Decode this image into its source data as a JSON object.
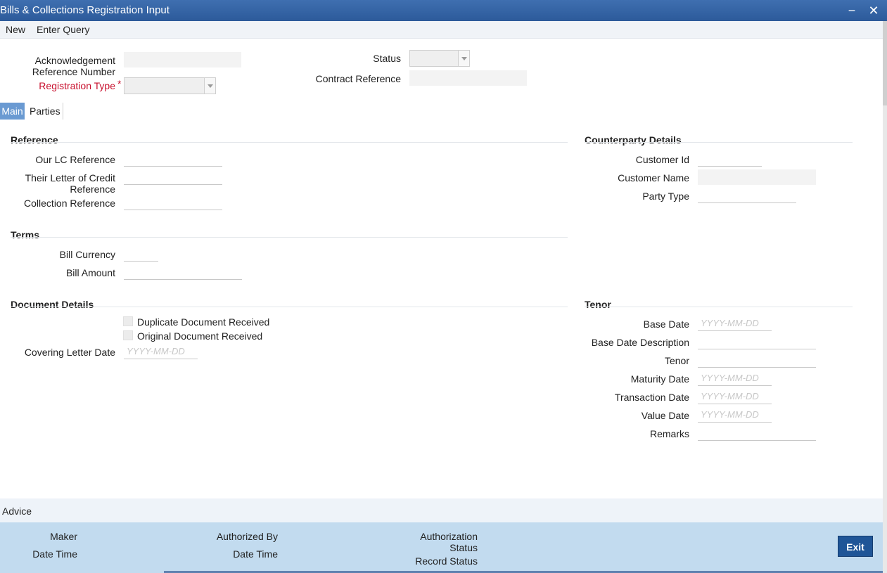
{
  "window": {
    "title": "Bills & Collections Registration Input",
    "minimize": "−",
    "close": "✕"
  },
  "menu": {
    "new": "New",
    "enter_query": "Enter Query"
  },
  "header": {
    "ack_ref_label": "Acknowledgement Reference Number",
    "reg_type_label": "Registration Type",
    "required_mark": "*",
    "status_label": "Status",
    "contract_ref_label": "Contract Reference"
  },
  "tabs": {
    "main": "Main",
    "parties": "Parties"
  },
  "reference": {
    "title": "Reference",
    "our_lc": "Our LC Reference",
    "their_lc": "Their Letter of Credit Reference",
    "collection": "Collection Reference"
  },
  "terms": {
    "title": "Terms",
    "currency": "Bill Currency",
    "amount": "Bill Amount"
  },
  "document": {
    "title": "Document Details",
    "duplicate": "Duplicate Document Received",
    "original": "Original Document Received",
    "covering_date": "Covering Letter Date"
  },
  "counterparty": {
    "title": "Counterparty Details",
    "customer_id": "Customer Id",
    "customer_name": "Customer Name",
    "party_type": "Party Type"
  },
  "tenor": {
    "title": "Tenor",
    "base_date": "Base Date",
    "base_date_desc": "Base Date Description",
    "tenor": "Tenor",
    "maturity_date": "Maturity Date",
    "transaction_date": "Transaction Date",
    "value_date": "Value Date",
    "remarks": "Remarks"
  },
  "date_placeholder": "YYYY-MM-DD",
  "advice": "Advice",
  "footer": {
    "maker": "Maker",
    "date_time": "Date Time",
    "authorized_by": "Authorized By",
    "auth_status": "Authorization Status",
    "record_status": "Record Status",
    "exit": "Exit"
  },
  "colors": {
    "titlebar": "#2f5f9f",
    "tab_active": "#6a9ad2",
    "required": "#c8102e",
    "footer_bg": "#c2dbef",
    "exit_button": "#1f5597"
  }
}
